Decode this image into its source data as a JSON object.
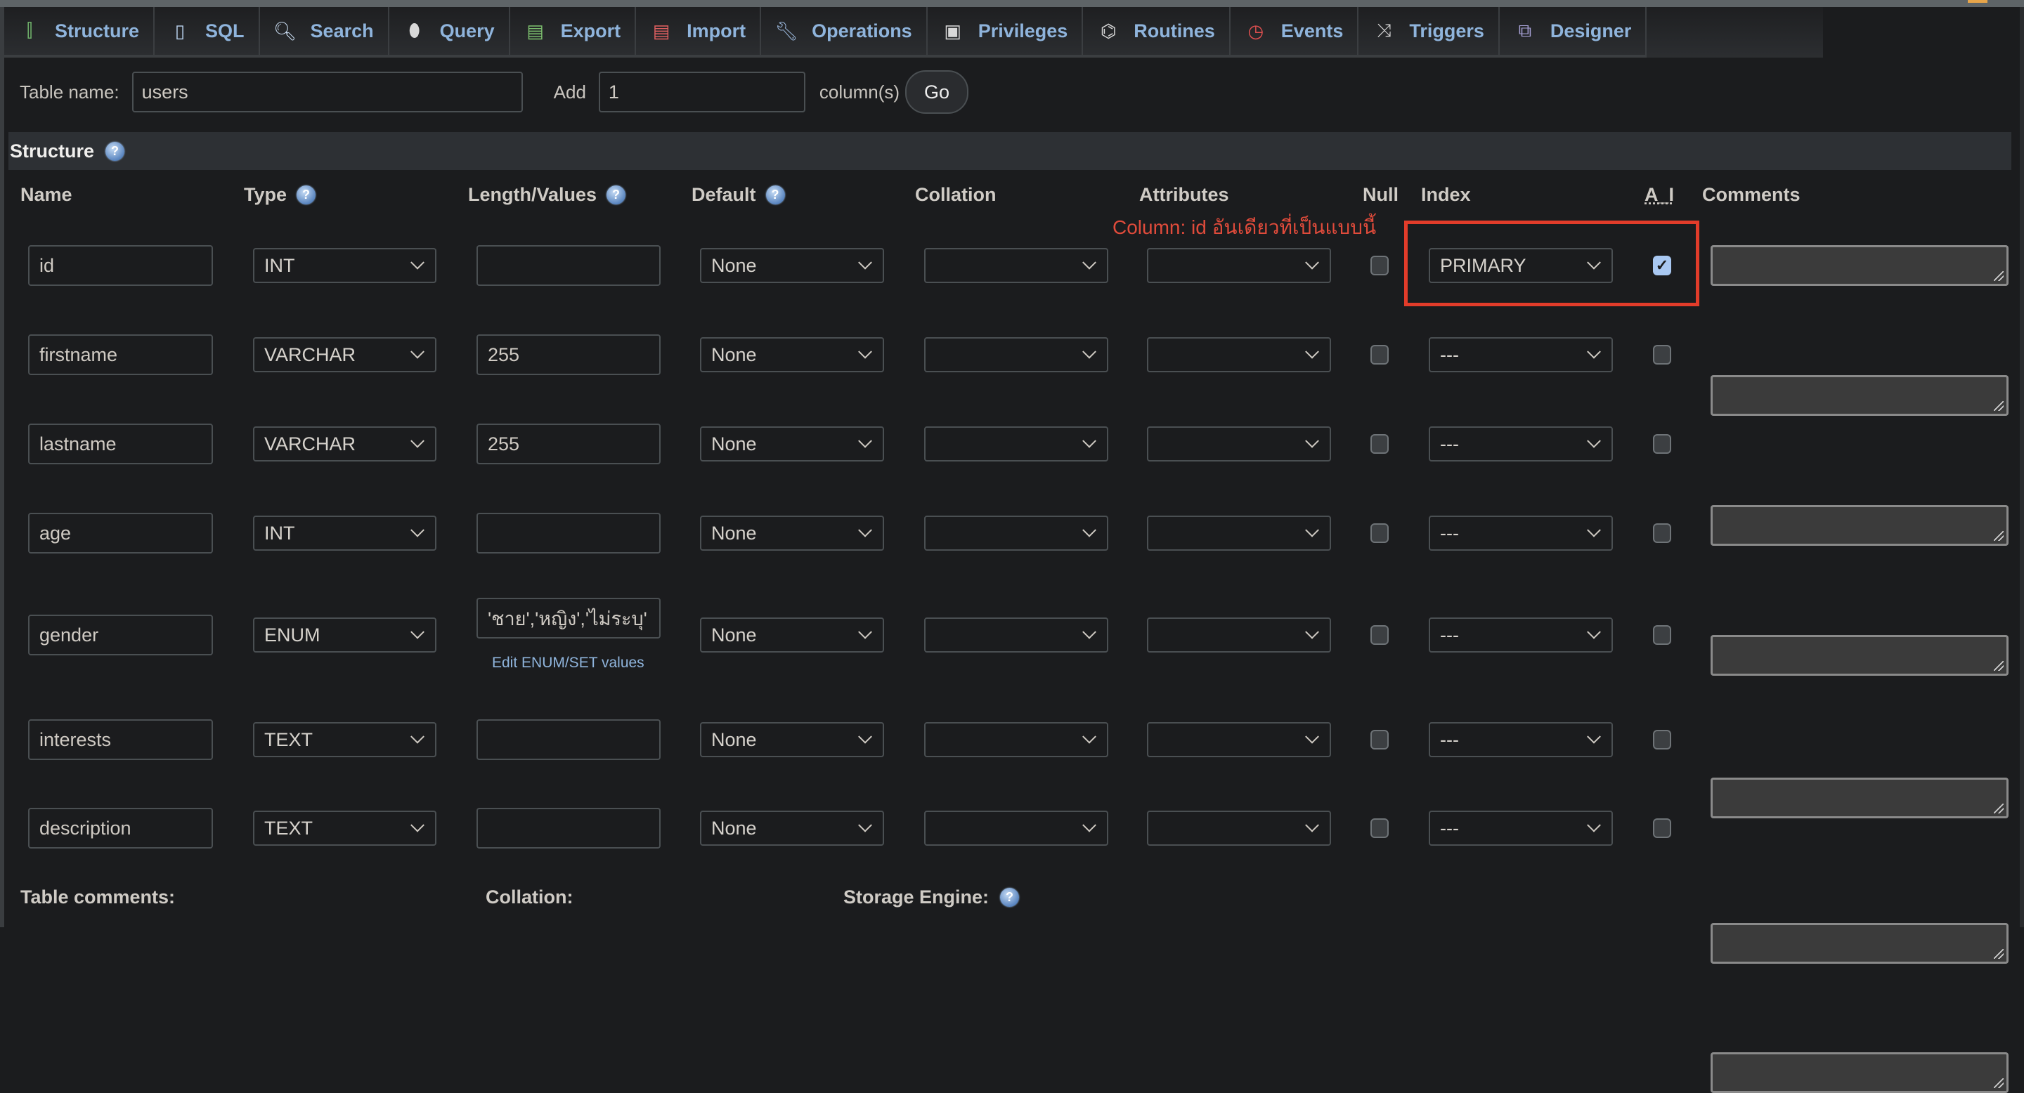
{
  "tabs": [
    {
      "label": "Structure",
      "icon": "structure-icon"
    },
    {
      "label": "SQL",
      "icon": "sql-icon"
    },
    {
      "label": "Search",
      "icon": "search-icon"
    },
    {
      "label": "Query",
      "icon": "query-icon"
    },
    {
      "label": "Export",
      "icon": "export-icon"
    },
    {
      "label": "Import",
      "icon": "import-icon"
    },
    {
      "label": "Operations",
      "icon": "operations-icon"
    },
    {
      "label": "Privileges",
      "icon": "privileges-icon"
    },
    {
      "label": "Routines",
      "icon": "routines-icon"
    },
    {
      "label": "Events",
      "icon": "events-icon"
    },
    {
      "label": "Triggers",
      "icon": "triggers-icon"
    },
    {
      "label": "Designer",
      "icon": "designer-icon"
    }
  ],
  "table_name": {
    "label": "Table name:",
    "value": "users"
  },
  "add_columns": {
    "label": "Add",
    "value": "1",
    "suffix": "column(s)",
    "go": "Go"
  },
  "section_title": "Structure",
  "headers": {
    "name": "Name",
    "type": "Type",
    "length": "Length/Values",
    "default": "Default",
    "collation": "Collation",
    "attributes": "Attributes",
    "null": "Null",
    "index": "Index",
    "ai": "A_I",
    "comments": "Comments"
  },
  "annotation": "Column: id อันเดียวที่เป็นแบบนี้",
  "columns": [
    {
      "name": "id",
      "type": "INT",
      "length": "",
      "default": "None",
      "collation": "",
      "attributes": "",
      "null": false,
      "index": "PRIMARY",
      "ai": true,
      "comments": ""
    },
    {
      "name": "firstname",
      "type": "VARCHAR",
      "length": "255",
      "default": "None",
      "collation": "",
      "attributes": "",
      "null": false,
      "index": "---",
      "ai": false,
      "comments": ""
    },
    {
      "name": "lastname",
      "type": "VARCHAR",
      "length": "255",
      "default": "None",
      "collation": "",
      "attributes": "",
      "null": false,
      "index": "---",
      "ai": false,
      "comments": ""
    },
    {
      "name": "age",
      "type": "INT",
      "length": "",
      "default": "None",
      "collation": "",
      "attributes": "",
      "null": false,
      "index": "---",
      "ai": false,
      "comments": ""
    },
    {
      "name": "gender",
      "type": "ENUM",
      "length": "'ชาย','หญิง','ไม่ระบุ'",
      "default": "None",
      "collation": "",
      "attributes": "",
      "null": false,
      "index": "---",
      "ai": false,
      "comments": "",
      "enum_link": "Edit ENUM/SET values"
    },
    {
      "name": "interests",
      "type": "TEXT",
      "length": "",
      "default": "None",
      "collation": "",
      "attributes": "",
      "null": false,
      "index": "---",
      "ai": false,
      "comments": ""
    },
    {
      "name": "description",
      "type": "TEXT",
      "length": "",
      "default": "None",
      "collation": "",
      "attributes": "",
      "null": false,
      "index": "---",
      "ai": false,
      "comments": ""
    }
  ],
  "footer": {
    "table_comments": "Table comments:",
    "collation": "Collation:",
    "storage_engine": "Storage Engine:"
  },
  "colors": {
    "accent": "#8fb4dc",
    "annotation": "#e04b3b",
    "background": "#1b1c1e"
  }
}
